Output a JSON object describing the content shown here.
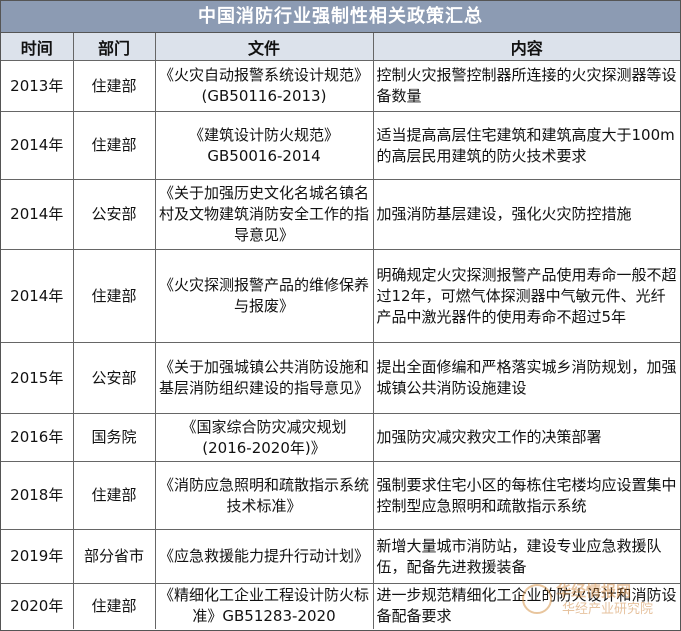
{
  "title": "中国消防行业强制性相关政策汇总",
  "headers": {
    "time": "时间",
    "dept": "部门",
    "doc": "文件",
    "content": "内容"
  },
  "rows": [
    {
      "time": "2013年",
      "dept": "住建部",
      "doc": "《火灾自动报警系统设计规范》(GB50116-2013)",
      "content": "控制火灾报警控制器所连接的火灾探测器等设备数量"
    },
    {
      "time": "2014年",
      "dept": "住建部",
      "doc": "《建筑设计防火规范》GB50016-2014",
      "content": "适当提高高层住宅建筑和建筑高度大于100m的高层民用建筑的防火技术要求"
    },
    {
      "time": "2014年",
      "dept": "公安部",
      "doc": "《关于加强历史文化名城名镇名村及文物建筑消防安全工作的指导意见》",
      "content": "加强消防基层建设，强化火灾防控措施"
    },
    {
      "time": "2014年",
      "dept": "住建部",
      "doc": "《火灾探测报警产品的维修保养与报废》",
      "content": "明确规定火灾探测报警产品使用寿命一般不超过12年，可燃气体探测器中气敏元件、光纤产品中激光器件的使用寿命不超过5年"
    },
    {
      "time": "2015年",
      "dept": "公安部",
      "doc": "《关于加强城镇公共消防设施和基层消防组织建设的指导意见》",
      "content": "提出全面修编和严格落实城乡消防规划，加强城镇公共消防设施建设"
    },
    {
      "time": "2016年",
      "dept": "国务院",
      "doc": "《国家综合防灾减灾规划(2016-2020年)》",
      "content": "加强防灾减灾救灾工作的决策部署"
    },
    {
      "time": "2018年",
      "dept": "住建部",
      "doc": "《消防应急照明和疏散指示系统技术标准》",
      "content": "强制要求住宅小区的每栋住宅楼均应设置集中控制型应急照明和疏散指示系统"
    },
    {
      "time": "2019年",
      "dept": "部分省市",
      "doc": "《应急救援能力提升行动计划》",
      "content": "新增大量城市消防站，建设专业应急救援队伍，配备先进救援装备"
    },
    {
      "time": "2020年",
      "dept": "住建部",
      "doc": "《精细化工企业工程设计防火标准》GB51283-2020",
      "content": "进一步规范精细化工企业的防火设计和消防设备配备要求"
    }
  ],
  "watermark": {
    "line1": "华经情报网",
    "line2": "华经产业研究院"
  }
}
